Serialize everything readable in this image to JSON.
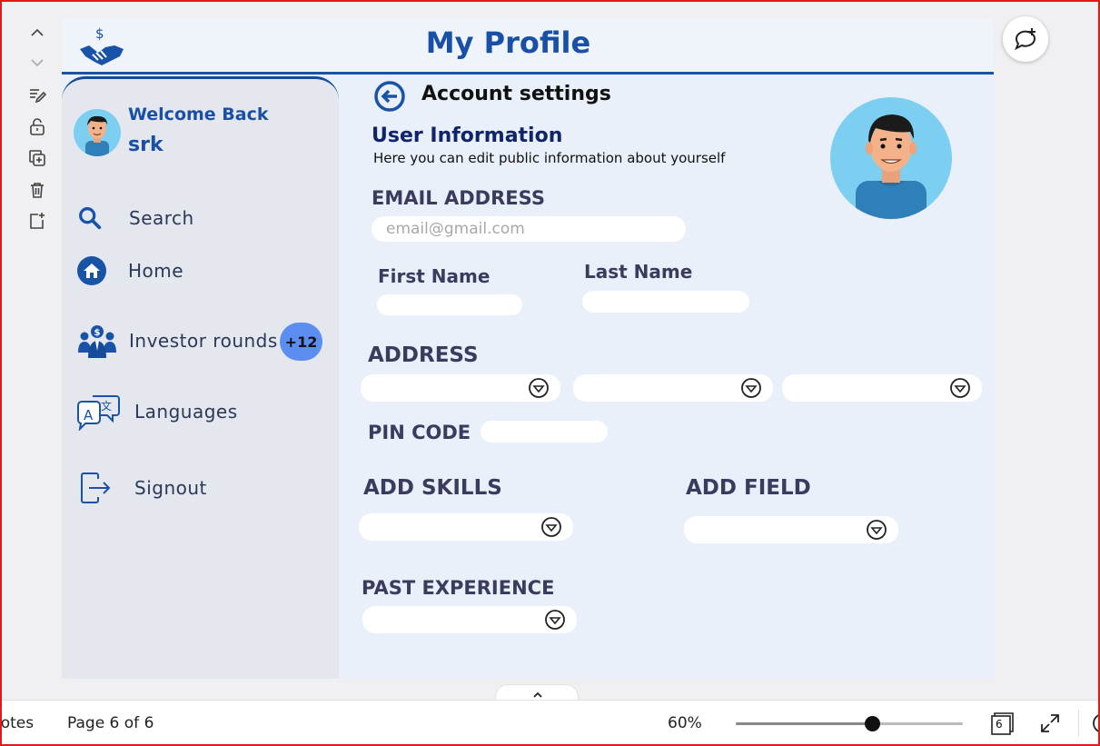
{
  "header": {
    "title": "My Profile"
  },
  "sidebar": {
    "welcome": "Welcome Back",
    "username": "srk",
    "items": [
      {
        "label": "Search",
        "icon": "search-icon"
      },
      {
        "label": "Home",
        "icon": "home-icon"
      },
      {
        "label": "Investor rounds",
        "icon": "investors-icon",
        "badge": "+12"
      },
      {
        "label": "Languages",
        "icon": "languages-icon"
      },
      {
        "label": "Signout",
        "icon": "signout-icon"
      }
    ]
  },
  "main": {
    "account_title": "Account settings",
    "section_title": "User Information",
    "section_subtitle": "Here you can edit public information about yourself",
    "email_label": "EMAIL ADDRESS",
    "email_placeholder": "email@gmail.com",
    "first_name_label": "First Name",
    "last_name_label": "Last Name",
    "address_label": "ADDRESS",
    "pin_label": "PIN CODE",
    "skills_label": "ADD SKILLS",
    "field_label": "ADD FIELD",
    "experience_label": "PAST EXPERIENCE"
  },
  "bottom_bar": {
    "notes_label": "Notes",
    "page_indicator": "Page 6 of 6",
    "zoom": "60%",
    "zoom_level": 0.6,
    "page_count": "6"
  },
  "colors": {
    "accent": "#1a4fa8",
    "badge": "#5b8ef0",
    "slide_bg": "#e9f0fa",
    "sidebar_bg": "#e4e8ee",
    "frame": "#e01a1a"
  }
}
